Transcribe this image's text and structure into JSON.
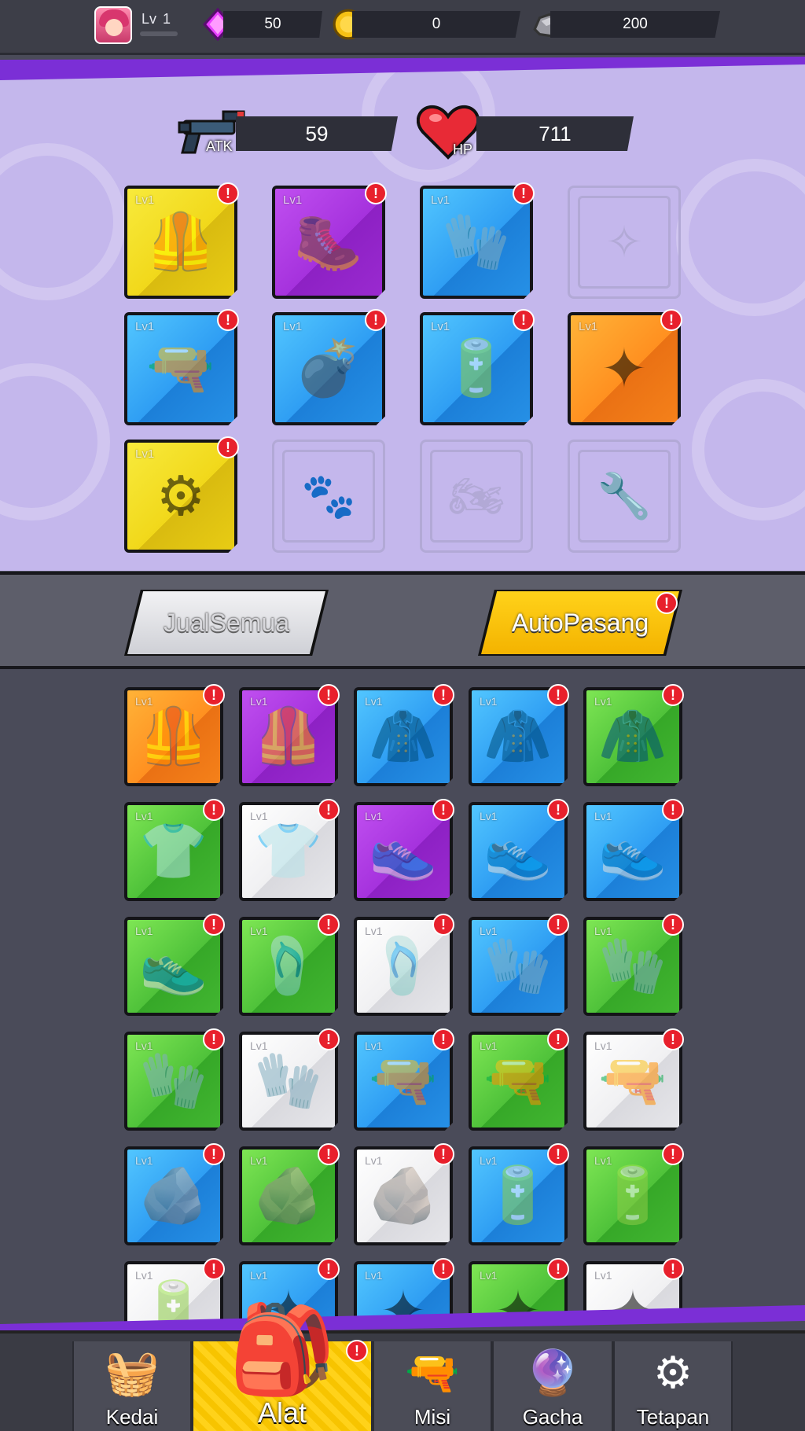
{
  "topbar": {
    "level_label": "Lv",
    "level_value": "1",
    "gems": "50",
    "coins": "0",
    "ore": "200",
    "colors": {
      "gem": "#e940ff",
      "coin": "#f6c114",
      "ore": "#9a9aa2"
    }
  },
  "stats": {
    "atk_label": "ATK",
    "atk_value": "59",
    "hp_label": "HP",
    "hp_value": "711"
  },
  "equipment": {
    "slots": [
      {
        "lv": "Lv1",
        "icon": "vest-icon",
        "rarity": "yellow",
        "badge": "!"
      },
      {
        "lv": "Lv1",
        "icon": "boot-icon",
        "rarity": "purple",
        "badge": "!"
      },
      {
        "lv": "Lv1",
        "icon": "glove-icon",
        "rarity": "blue",
        "badge": "!"
      },
      {
        "lv": "",
        "icon": "crystal-icon",
        "rarity": "empty",
        "badge": ""
      },
      {
        "lv": "Lv1",
        "icon": "shotgun-icon",
        "rarity": "blue",
        "badge": "!"
      },
      {
        "lv": "Lv1",
        "icon": "bomb-icon",
        "rarity": "blue",
        "badge": "!"
      },
      {
        "lv": "Lv1",
        "icon": "battery-icon",
        "rarity": "blue",
        "badge": "!"
      },
      {
        "lv": "Lv1",
        "icon": "shuriken-icon",
        "rarity": "orange",
        "badge": "!"
      },
      {
        "lv": "Lv1",
        "icon": "sawblade-icon",
        "rarity": "yellow",
        "badge": "!"
      },
      {
        "lv": "",
        "icon": "paw-icon",
        "rarity": "empty",
        "badge": ""
      },
      {
        "lv": "",
        "icon": "motorcycle-icon",
        "rarity": "empty",
        "badge": ""
      },
      {
        "lv": "",
        "icon": "wrench-icon",
        "rarity": "empty",
        "badge": ""
      }
    ]
  },
  "actions": {
    "sell_all": "JualSemua",
    "auto_equip": "AutoPasang",
    "auto_badge": "!"
  },
  "inventory": {
    "items": [
      {
        "lv": "Lv1",
        "icon": "tactical-vest-icon",
        "rarity": "orange"
      },
      {
        "lv": "Lv1",
        "icon": "vest-icon",
        "rarity": "purple"
      },
      {
        "lv": "Lv1",
        "icon": "jacket-icon",
        "rarity": "blue"
      },
      {
        "lv": "Lv1",
        "icon": "jacket-icon",
        "rarity": "blue"
      },
      {
        "lv": "Lv1",
        "icon": "jacket-icon",
        "rarity": "green"
      },
      {
        "lv": "Lv1",
        "icon": "shirt-icon",
        "rarity": "green"
      },
      {
        "lv": "Lv1",
        "icon": "shirt-icon",
        "rarity": "white"
      },
      {
        "lv": "Lv1",
        "icon": "sneaker-icon",
        "rarity": "purple"
      },
      {
        "lv": "Lv1",
        "icon": "sneaker-icon",
        "rarity": "blue"
      },
      {
        "lv": "Lv1",
        "icon": "sneaker-icon",
        "rarity": "blue"
      },
      {
        "lv": "Lv1",
        "icon": "sneaker-icon",
        "rarity": "green"
      },
      {
        "lv": "Lv1",
        "icon": "sandal-icon",
        "rarity": "green"
      },
      {
        "lv": "Lv1",
        "icon": "sandal-icon",
        "rarity": "white"
      },
      {
        "lv": "Lv1",
        "icon": "glove-icon",
        "rarity": "blue"
      },
      {
        "lv": "Lv1",
        "icon": "glove-icon",
        "rarity": "green"
      },
      {
        "lv": "Lv1",
        "icon": "glove-icon",
        "rarity": "green"
      },
      {
        "lv": "Lv1",
        "icon": "glove-icon",
        "rarity": "white"
      },
      {
        "lv": "Lv1",
        "icon": "rifle-icon",
        "rarity": "blue"
      },
      {
        "lv": "Lv1",
        "icon": "rifle-icon",
        "rarity": "green"
      },
      {
        "lv": "Lv1",
        "icon": "rifle-icon",
        "rarity": "white"
      },
      {
        "lv": "Lv1",
        "icon": "rock-icon",
        "rarity": "blue"
      },
      {
        "lv": "Lv1",
        "icon": "rock-icon",
        "rarity": "green"
      },
      {
        "lv": "Lv1",
        "icon": "rock-icon",
        "rarity": "white"
      },
      {
        "lv": "Lv1",
        "icon": "battery-icon",
        "rarity": "blue"
      },
      {
        "lv": "Lv1",
        "icon": "battery-icon",
        "rarity": "green"
      },
      {
        "lv": "Lv1",
        "icon": "battery-icon",
        "rarity": "white"
      },
      {
        "lv": "Lv1",
        "icon": "shuriken-icon",
        "rarity": "blue"
      },
      {
        "lv": "Lv1",
        "icon": "shuriken-icon",
        "rarity": "blue"
      },
      {
        "lv": "Lv1",
        "icon": "shuriken-icon",
        "rarity": "green"
      },
      {
        "lv": "Lv1",
        "icon": "shuriken-icon",
        "rarity": "white"
      }
    ],
    "badge": "!"
  },
  "nav": {
    "tabs": [
      {
        "label": "Kedai",
        "icon": "basket-icon"
      },
      {
        "label": "Alat",
        "icon": "backpack-icon",
        "badge": "!"
      },
      {
        "label": "Misi",
        "icon": "gun-icon"
      },
      {
        "label": "Gacha",
        "icon": "gacha-orb-icon"
      },
      {
        "label": "Tetapan",
        "icon": "gear-icon"
      }
    ]
  }
}
